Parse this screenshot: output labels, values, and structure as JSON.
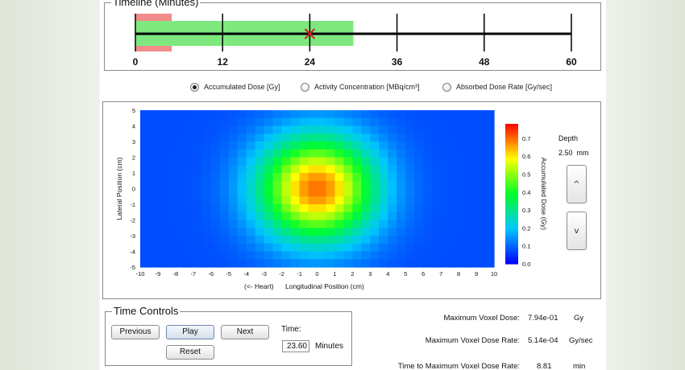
{
  "timeline": {
    "title": "Timeline (Minutes)",
    "ticks": [
      "0",
      "12",
      "24",
      "36",
      "48",
      "60"
    ],
    "max": 60,
    "red_range": [
      0,
      5
    ],
    "green_range": [
      0,
      30
    ],
    "marker": 24,
    "colors": {
      "red": "#f28b8b",
      "green": "#7ee87e",
      "marker": "#d62020",
      "line": "#000000"
    }
  },
  "mode_radios": [
    {
      "label": "Accumulated Dose [Gy]",
      "checked": true
    },
    {
      "label": "Activity Concentration [MBq/cm³]",
      "checked": false
    },
    {
      "label": "Absorbed Dose Rate [Gy/sec]",
      "checked": false
    }
  ],
  "chart_data": {
    "type": "heatmap",
    "xlabel": "Longitudinal Position (cm)",
    "xlabel_prefix": "(<- Heart)",
    "ylabel": "Lateral Position (cm)",
    "xlim": [
      -10,
      10
    ],
    "ylim": [
      -5,
      5
    ],
    "x_ticks": [
      "-10",
      "-9",
      "-8",
      "-7",
      "-6",
      "-5",
      "-4",
      "-3",
      "-2",
      "-1",
      "0",
      "1",
      "2",
      "3",
      "4",
      "5",
      "6",
      "7",
      "8",
      "9",
      "10"
    ],
    "y_ticks": [
      "5",
      "4",
      "3",
      "2",
      "1",
      "0",
      "-1",
      "-2",
      "-3",
      "-4",
      "-5"
    ],
    "grid_cols": 40,
    "grid_rows": 20,
    "peak_center": [
      0,
      0
    ],
    "peak_value": 0.794,
    "colorbar": {
      "label": "Accumulated Dose (Gy)",
      "ticks": [
        "0.7",
        "0.6",
        "0.5",
        "0.4",
        "0.3",
        "0.2",
        "0.1",
        "0.0"
      ],
      "range": [
        0,
        0.78
      ]
    }
  },
  "depth": {
    "label": "Depth",
    "value": "2.50",
    "unit": "mm",
    "up": "^",
    "down": "v"
  },
  "time_controls": {
    "title": "Time Controls",
    "previous": "Previous",
    "play": "Play",
    "next": "Next",
    "reset": "Reset",
    "time_label": "Time:",
    "time_value": "23.60",
    "time_unit": "Minutes"
  },
  "stats": {
    "max_voxel_dose": {
      "label": "Maximum Voxel Dose:",
      "value": "7.94e-01",
      "unit": "Gy"
    },
    "max_voxel_dose_rate": {
      "label": "Maximum Voxel Dose Rate:",
      "value": "5.14e-04",
      "unit": "Gy/sec"
    },
    "time_to_max": {
      "label": "Time to Maximum Voxel Dose Rate:",
      "value": "8.81",
      "unit": "min"
    }
  }
}
